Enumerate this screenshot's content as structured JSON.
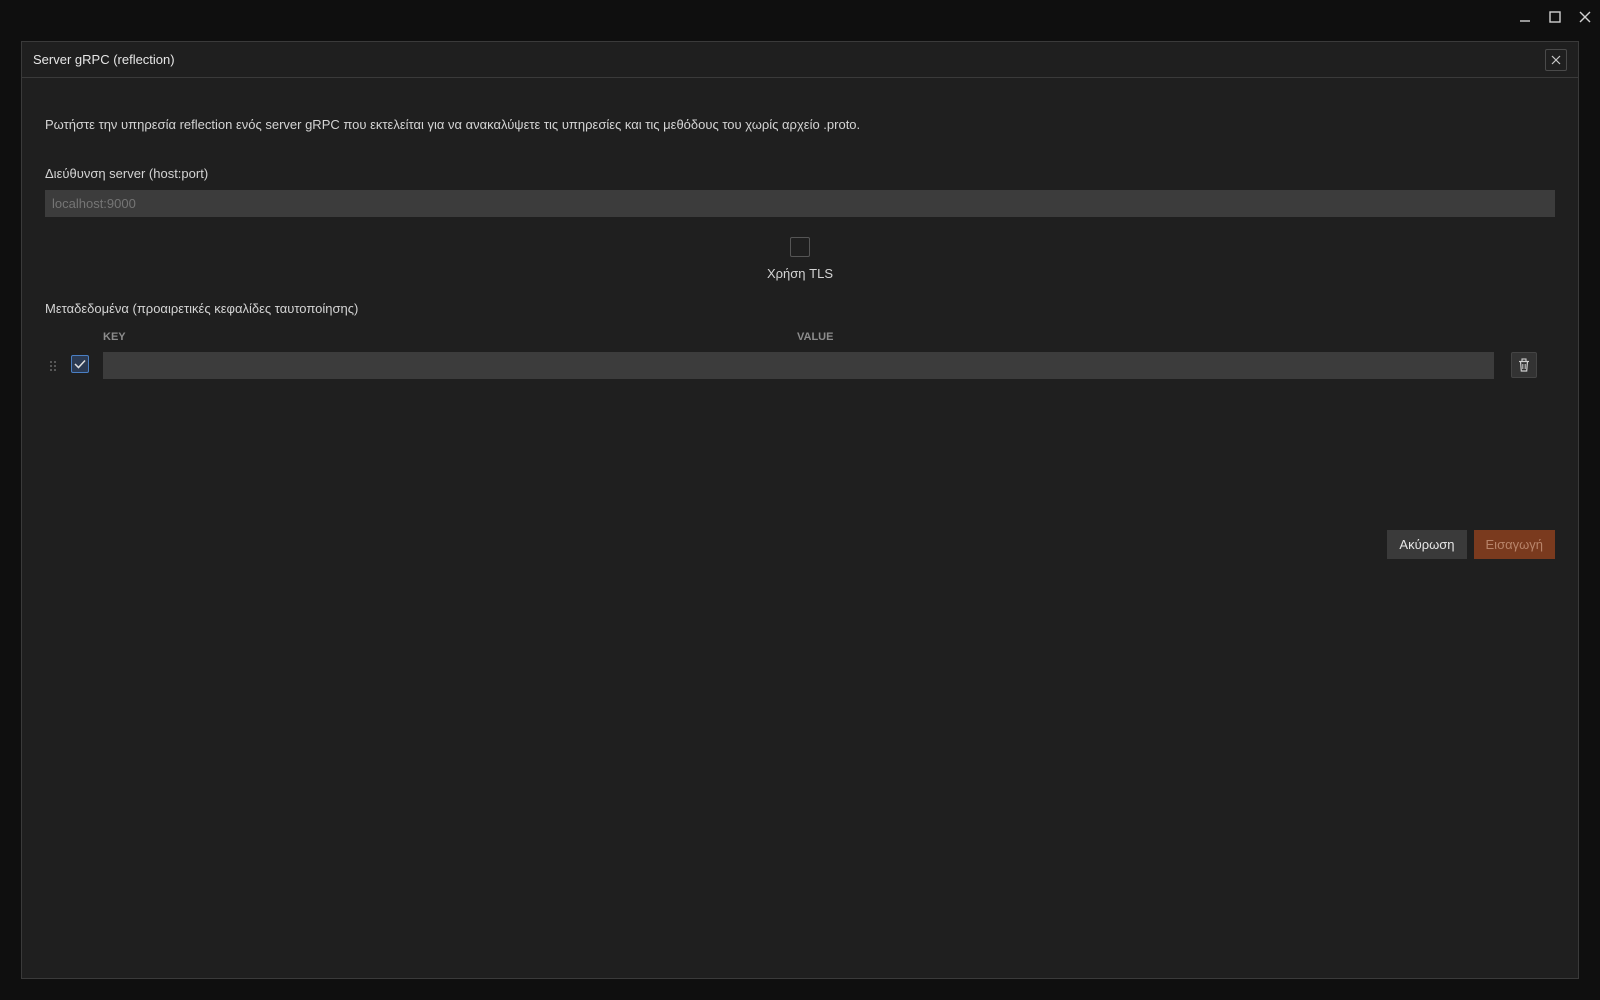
{
  "window": {
    "minimize_icon": "minimize-icon",
    "maximize_icon": "maximize-icon",
    "close_icon": "close-icon"
  },
  "dialog": {
    "title": "Server gRPC (reflection)",
    "description": "Ρωτήστε την υπηρεσία reflection ενός server gRPC που εκτελείται για να ανακαλύψετε τις υπηρεσίες και τις μεθόδους του χωρίς αρχείο .proto.",
    "host_label": "Διεύθυνση server (host:port)",
    "host_placeholder": "localhost:9000",
    "host_value": "",
    "tls_label": "Χρήση TLS",
    "tls_checked": false,
    "metadata_label": "Μεταδεδομένα (προαιρετικές κεφαλίδες ταυτοποίησης)",
    "columns": {
      "key": "KEY",
      "value": "VALUE"
    },
    "rows": [
      {
        "enabled": true,
        "key": "",
        "value": ""
      }
    ],
    "buttons": {
      "cancel": "Ακύρωση",
      "import": "Εισαγωγή"
    }
  },
  "colors": {
    "background": "#1f1f1f",
    "input": "#3c3c3c",
    "accent": "#7a3a1e",
    "checkbox_accent": "#4a7fc4"
  }
}
